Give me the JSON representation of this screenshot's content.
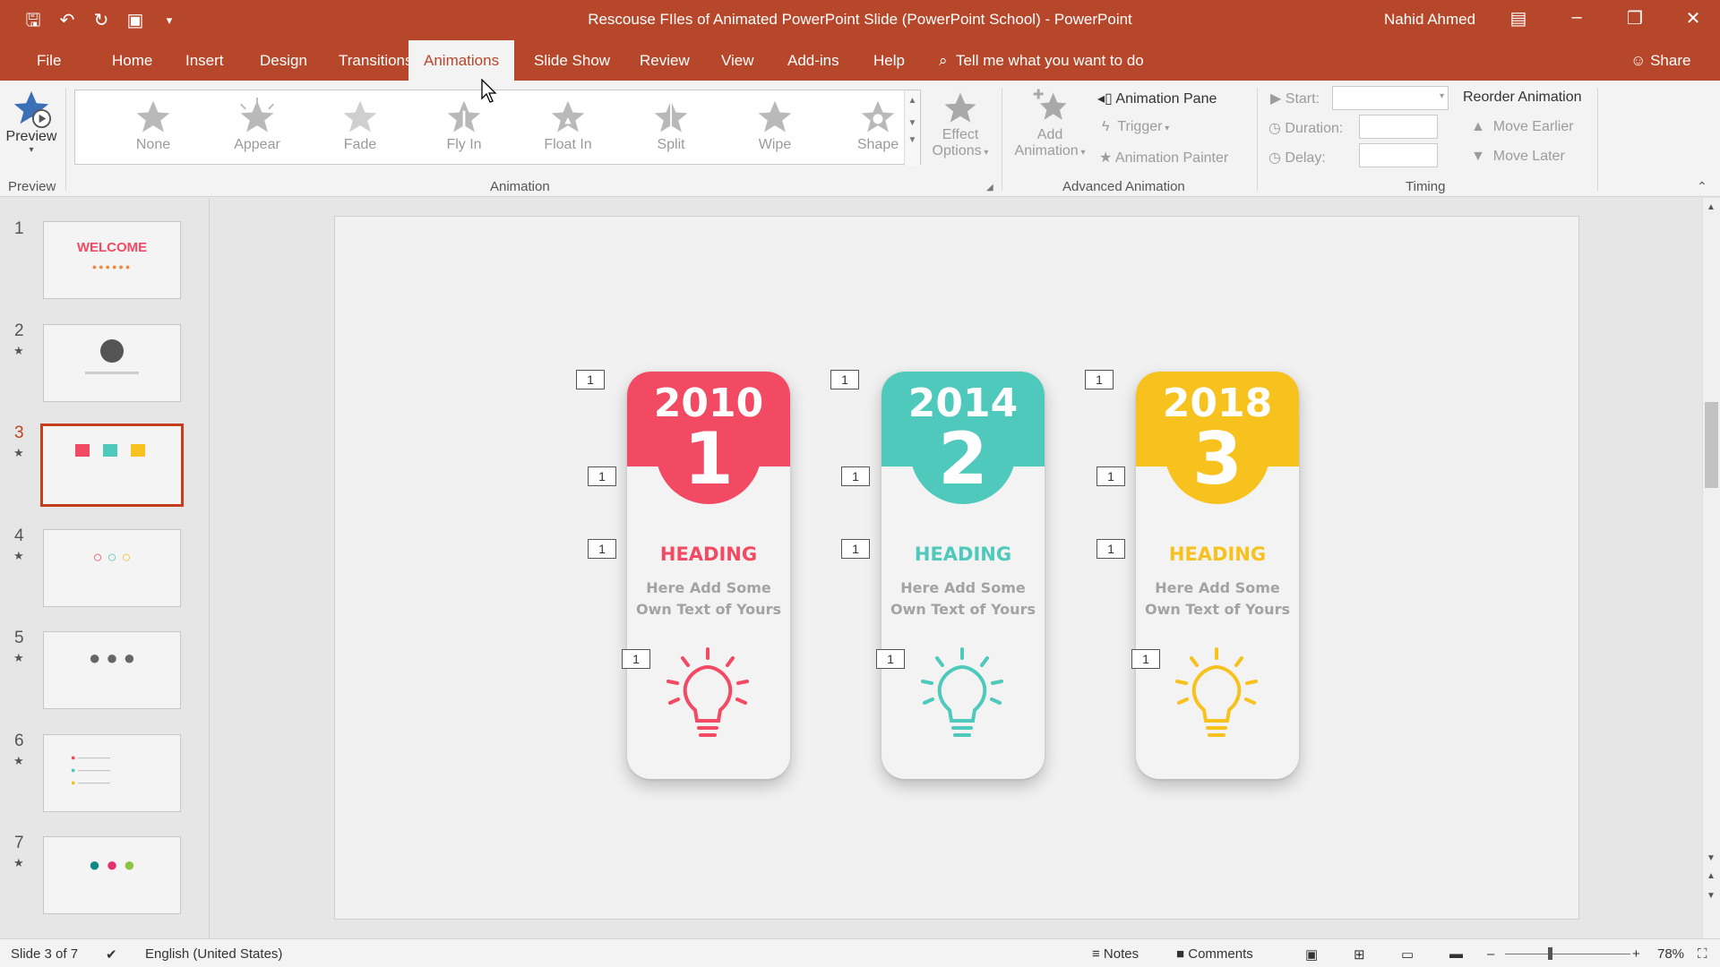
{
  "window": {
    "title": "Rescouse FIles of Animated PowerPoint Slide (PowerPoint School)  -  PowerPoint",
    "user": "Nahid Ahmed"
  },
  "tabs": [
    "File",
    "Home",
    "Insert",
    "Design",
    "Transitions",
    "Animations",
    "Slide Show",
    "Review",
    "View",
    "Add-ins",
    "Help"
  ],
  "active_tab": "Animations",
  "tell_me": "Tell me what you want to do",
  "share": "Share",
  "ribbon": {
    "preview": {
      "label": "Preview",
      "group": "Preview"
    },
    "animation_group": "Animation",
    "gallery": [
      "None",
      "Appear",
      "Fade",
      "Fly In",
      "Float In",
      "Split",
      "Wipe",
      "Shape"
    ],
    "effect_options": [
      "Effect",
      "Options"
    ],
    "add_animation": [
      "Add",
      "Animation"
    ],
    "advanced": {
      "group": "Advanced Animation",
      "animation_pane": "Animation Pane",
      "trigger": "Trigger",
      "painter": "Animation Painter"
    },
    "timing": {
      "group": "Timing",
      "start": "Start:",
      "duration": "Duration:",
      "delay": "Delay:",
      "reorder": "Reorder Animation",
      "move_earlier": "Move Earlier",
      "move_later": "Move Later"
    }
  },
  "slides": [
    {
      "num": "1",
      "star": ""
    },
    {
      "num": "2",
      "star": "★"
    },
    {
      "num": "3",
      "star": "★"
    },
    {
      "num": "4",
      "star": "★"
    },
    {
      "num": "5",
      "star": "★"
    },
    {
      "num": "6",
      "star": "★"
    },
    {
      "num": "7",
      "star": "★"
    }
  ],
  "thumb_text": {
    "welcome": "WELCOME"
  },
  "selected_slide": 3,
  "cards": [
    {
      "year": "2010",
      "num": "1",
      "heading": "HEADING",
      "line1": "Here Add Some",
      "line2": "Own Text of Yours",
      "color": "#f24a62"
    },
    {
      "year": "2014",
      "num": "2",
      "heading": "HEADING",
      "line1": "Here Add Some",
      "line2": "Own Text of Yours",
      "color": "#4ec9bb"
    },
    {
      "year": "2018",
      "num": "3",
      "heading": "HEADING",
      "line1": "Here Add Some",
      "line2": "Own Text of Yours",
      "color": "#f7c21d"
    }
  ],
  "anim_tag": "1",
  "status": {
    "slide": "Slide 3 of 7",
    "language": "English (United States)",
    "notes": "Notes",
    "comments": "Comments",
    "zoom": "78%"
  },
  "colors": {
    "accent": "#b7472a",
    "selection": "#c43e1c"
  },
  "icons": [
    "save-icon",
    "undo-icon",
    "redo-icon",
    "present-icon",
    "star-icon",
    "lightbulb-icon",
    "search-icon",
    "person-icon"
  ]
}
